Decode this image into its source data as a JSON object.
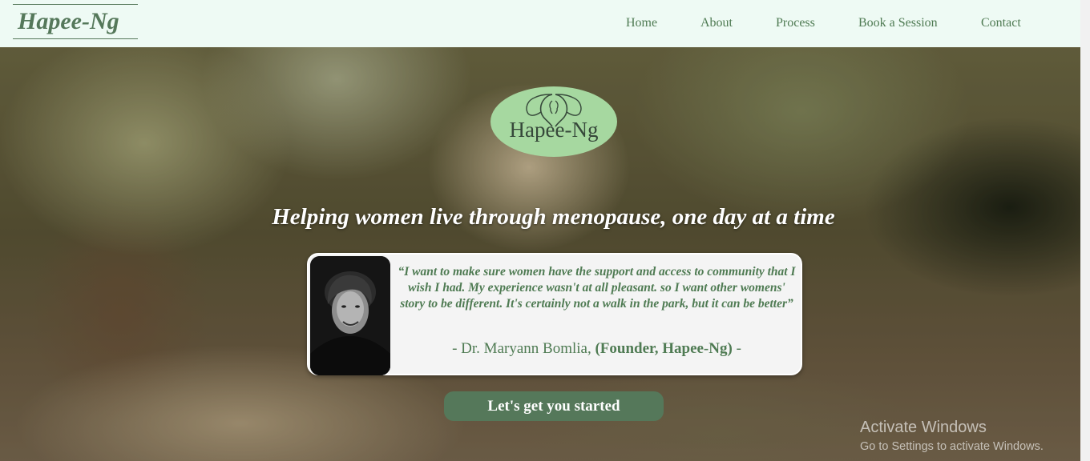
{
  "nav": {
    "brand": "Hapee-Ng",
    "links": [
      "Home",
      "About",
      "Process",
      "Book a Session",
      "Contact"
    ]
  },
  "hero": {
    "logo_text": "Hapee-Ng",
    "headline": "Helping women live through menopause, one day at a time",
    "quote": "“I want to make sure women have the support and access to community that I wish I had. My experience wasn't at all pleasant. so I want other womens' story to be different. It's certainly not a walk in the park, but it can be better”",
    "attribution": {
      "prefix": "- Dr. Maryann Bomlia, ",
      "role": "(Founder, Hapee-Ng)",
      "suffix": " -"
    },
    "cta_label": "Let's get you started"
  },
  "watermark": {
    "title": "Activate Windows",
    "subtitle": "Go to Settings to activate Windows."
  },
  "colors": {
    "brand_green": "#55785a",
    "nav_background": "#eefaf4",
    "logo_ellipse": "#a6d8a0"
  }
}
